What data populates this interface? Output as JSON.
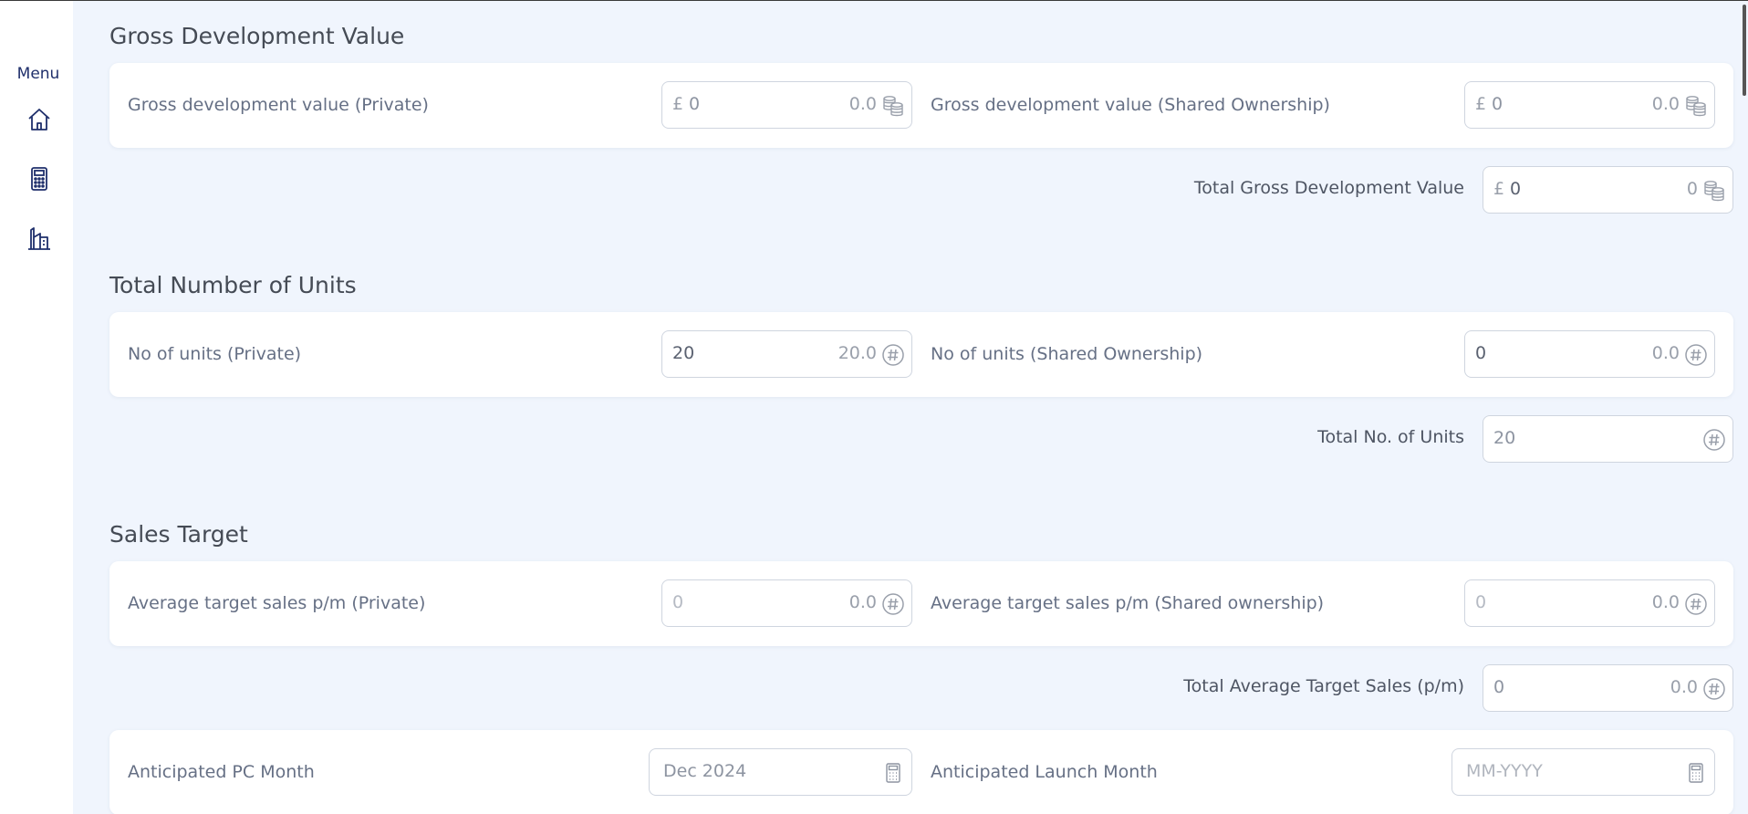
{
  "sidebar": {
    "menu_label": "Menu",
    "icons": [
      "home-icon",
      "calculator-icon",
      "building-icon"
    ]
  },
  "gdv": {
    "title": "Gross Development Value",
    "private": {
      "label": "Gross development value (Private)",
      "prefix": "£",
      "value": "0",
      "formatted": "0.0",
      "icon": "coins-icon"
    },
    "shared": {
      "label": "Gross development value (Shared Ownership)",
      "prefix": "£",
      "value": "0",
      "formatted": "0.0",
      "icon": "coins-icon"
    },
    "total": {
      "label": "Total Gross Development Value",
      "prefix": "£",
      "value": "0",
      "formatted": "0",
      "icon": "coins-icon"
    }
  },
  "units": {
    "title": "Total Number of Units",
    "private": {
      "label": "No of units (Private)",
      "value": "20",
      "formatted": "20.0",
      "icon": "hash-icon"
    },
    "shared": {
      "label": "No of units (Shared Ownership)",
      "value": "0",
      "formatted": "0.0",
      "icon": "hash-icon"
    },
    "total": {
      "label": "Total No. of Units",
      "value": "20",
      "formatted": "",
      "icon": "hash-icon"
    }
  },
  "sales": {
    "title": "Sales Target",
    "private": {
      "label": "Average target sales p/m (Private)",
      "placeholder": "0",
      "formatted": "0.0",
      "icon": "hash-icon"
    },
    "shared": {
      "label": "Average target sales p/m (Shared ownership)",
      "placeholder": "0",
      "formatted": "0.0",
      "icon": "hash-icon"
    },
    "total": {
      "label": "Total Average Target Sales (p/m)",
      "value": "0",
      "formatted": "0.0",
      "icon": "hash-icon"
    }
  },
  "dates": {
    "pc_month": {
      "label": "Anticipated PC Month",
      "value": "Dec 2024",
      "icon": "calculator-icon"
    },
    "launch_month": {
      "label": "Anticipated Launch Month",
      "placeholder": "MM-YYYY",
      "icon": "calculator-icon"
    }
  },
  "colors": {
    "background": "#f0f5fd",
    "card": "#ffffff",
    "accent": "#1f2f6b",
    "border": "#cfd5df"
  }
}
